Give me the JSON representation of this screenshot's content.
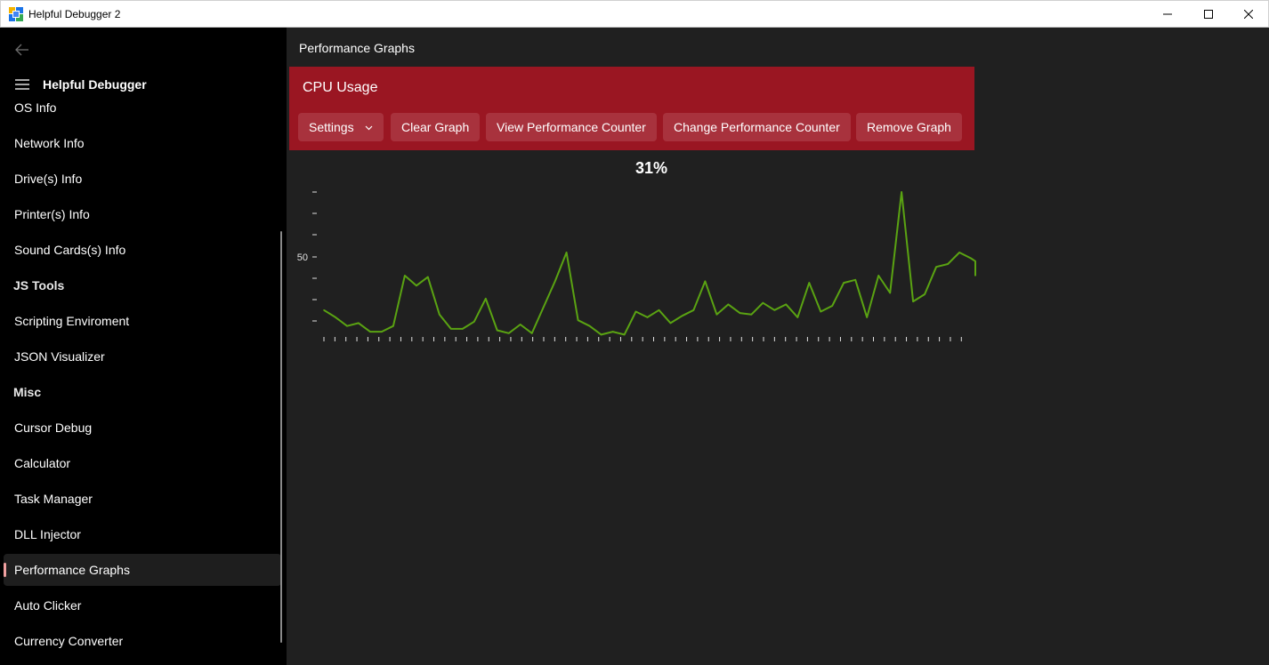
{
  "window": {
    "title": "Helpful Debugger 2",
    "icon": "app-logo-icon",
    "buttons": [
      "minimize-icon",
      "maximize-icon",
      "close-icon"
    ]
  },
  "sidebar": {
    "brand": "Helpful Debugger",
    "items": [
      {
        "label": "OS Info",
        "type": "item"
      },
      {
        "label": "Network Info",
        "type": "item"
      },
      {
        "label": "Drive(s) Info",
        "type": "item"
      },
      {
        "label": "Printer(s) Info",
        "type": "item"
      },
      {
        "label": "Sound Cards(s) Info",
        "type": "item"
      },
      {
        "label": "JS Tools",
        "type": "header"
      },
      {
        "label": "Scripting Enviroment",
        "type": "item"
      },
      {
        "label": "JSON Visualizer",
        "type": "item"
      },
      {
        "label": "Misc",
        "type": "header"
      },
      {
        "label": "Cursor Debug",
        "type": "item"
      },
      {
        "label": "Calculator",
        "type": "item"
      },
      {
        "label": "Task Manager",
        "type": "item"
      },
      {
        "label": "DLL Injector",
        "type": "item"
      },
      {
        "label": "Performance Graphs",
        "type": "item",
        "selected": true
      },
      {
        "label": "Auto Clicker",
        "type": "item"
      },
      {
        "label": "Currency Converter",
        "type": "item"
      }
    ]
  },
  "main": {
    "page_title": "Performance Graphs",
    "card": {
      "title": "CPU Usage",
      "buttons": {
        "settings": "Settings",
        "clear": "Clear Graph",
        "view": "View Performance Counter",
        "change": "Change Performance Counter",
        "remove": "Remove Graph"
      }
    },
    "current_value": "31%"
  },
  "colors": {
    "accent": "#9a1622",
    "line": "#5aa312",
    "sidebar_bg": "#000000",
    "content_bg": "#202020"
  },
  "chart_data": {
    "type": "line",
    "ytick_labels": [
      "50"
    ],
    "ylim": [
      0,
      100
    ],
    "series": [
      {
        "values": [
          18,
          13,
          7,
          9,
          3,
          3,
          7,
          42,
          35,
          41,
          15,
          5,
          5,
          10,
          26,
          4,
          2,
          8,
          2,
          20,
          38,
          58,
          11,
          7,
          1,
          3,
          1,
          17,
          13,
          18,
          9,
          14,
          18,
          38,
          15,
          22,
          16,
          15,
          23,
          18,
          22,
          13,
          37,
          17,
          21,
          37,
          39,
          13,
          42,
          30,
          100,
          24,
          29,
          48,
          50,
          58,
          54,
          52,
          42
        ]
      }
    ]
  }
}
